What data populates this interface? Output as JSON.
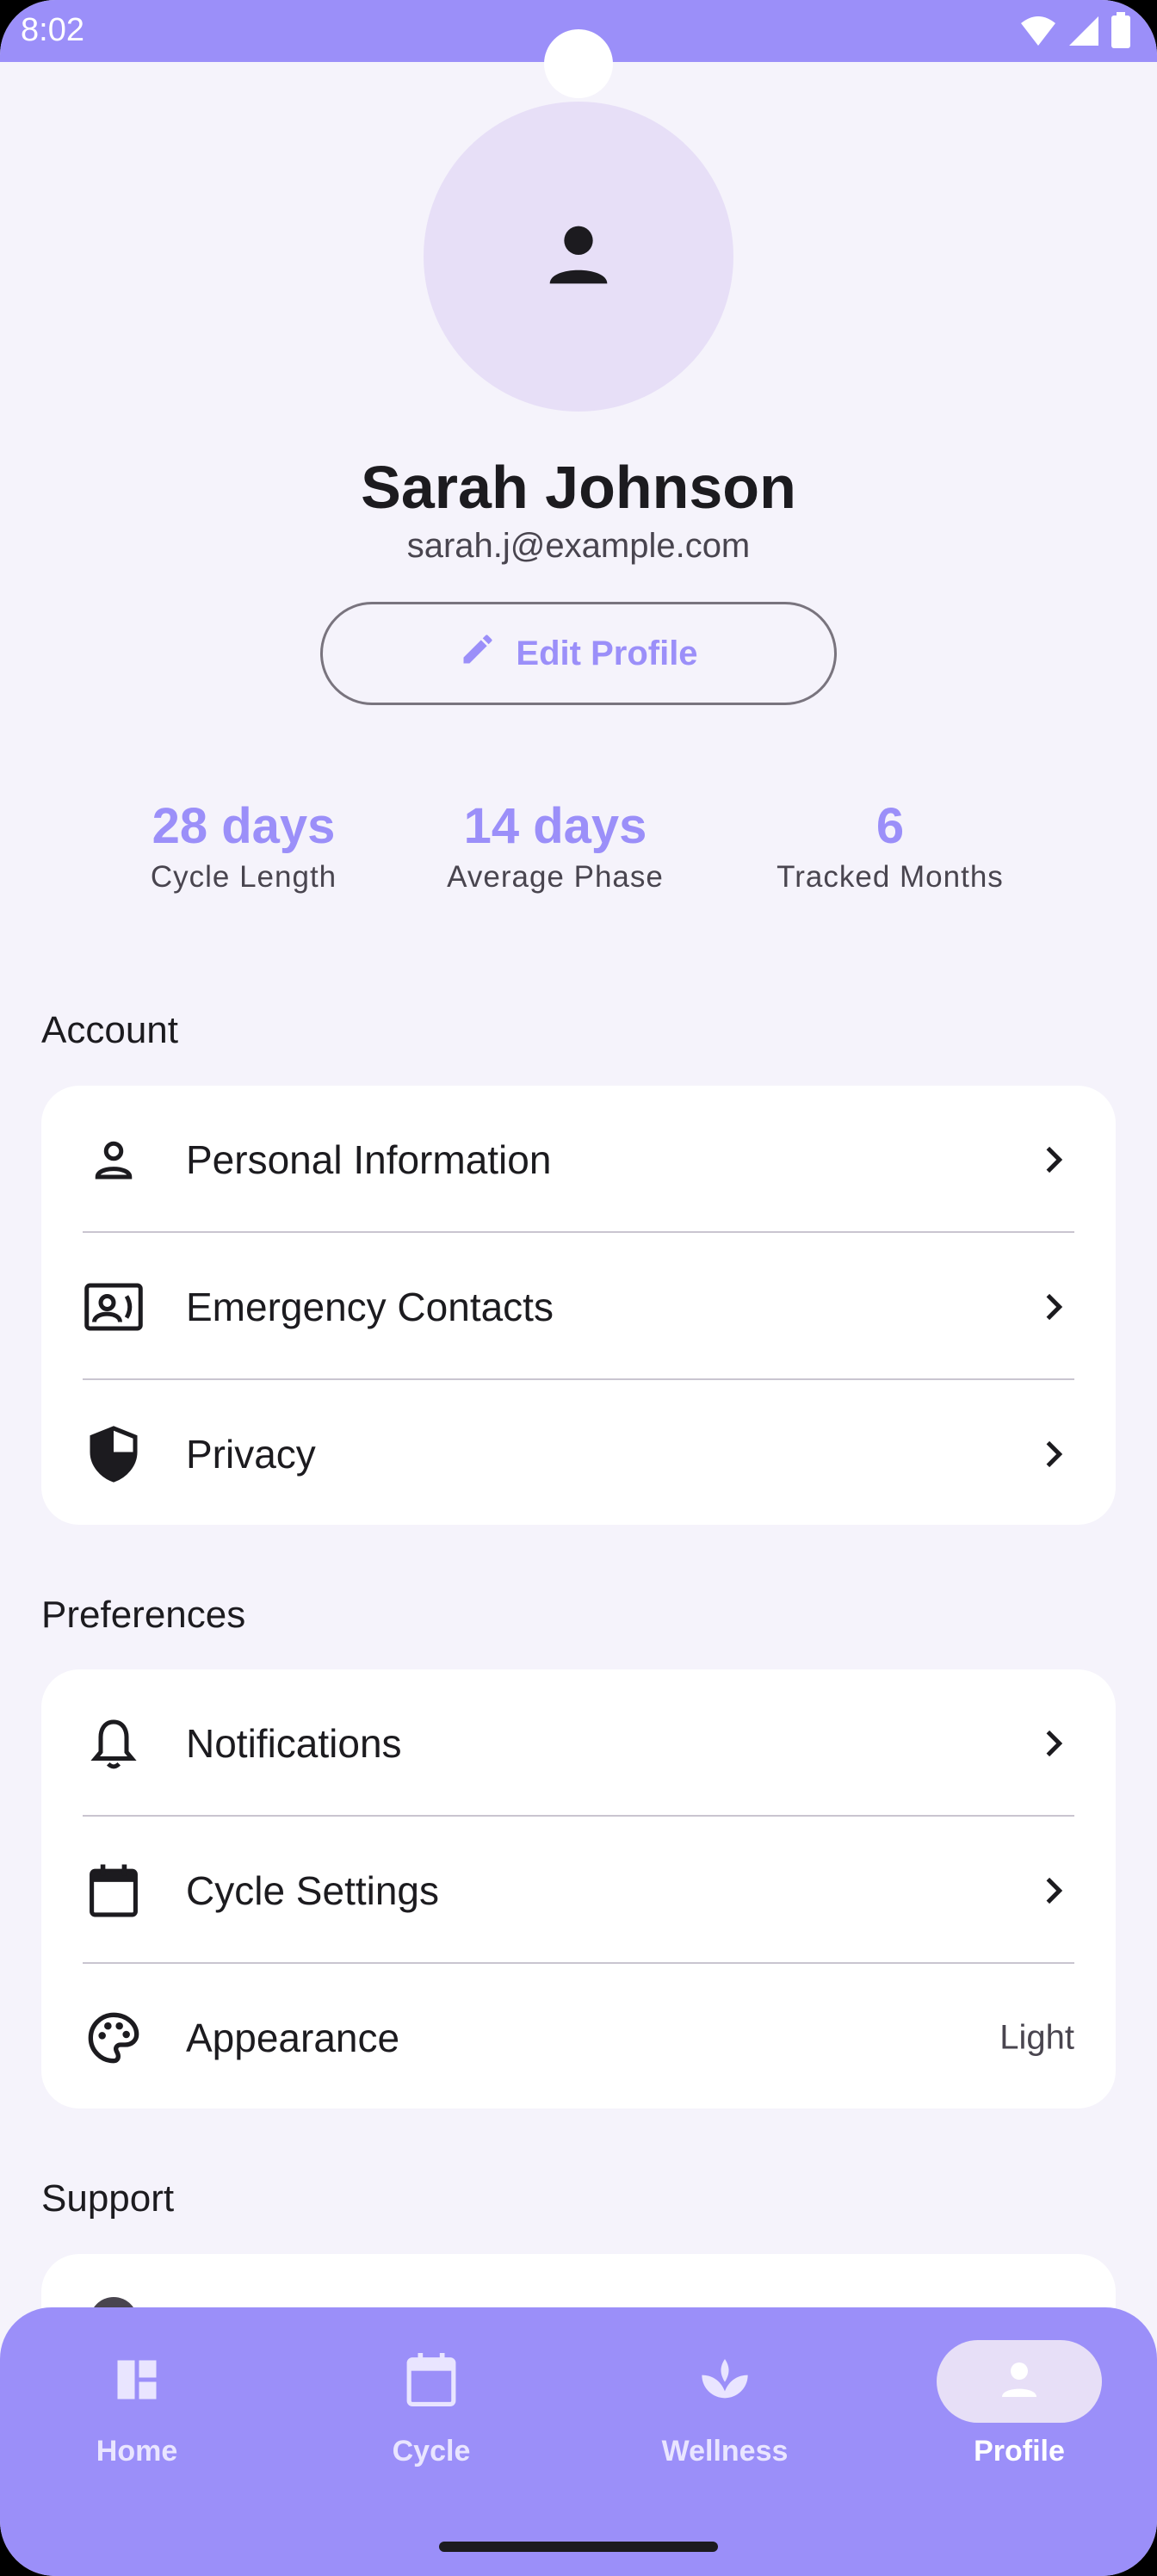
{
  "status_bar": {
    "time": "8:02",
    "icons": [
      "wifi-icon",
      "signal-icon",
      "battery-icon"
    ]
  },
  "profile": {
    "name": "Sarah Johnson",
    "email": "sarah.j@example.com",
    "edit_label": "Edit Profile",
    "avatar_icon": "person-icon"
  },
  "stats": [
    {
      "value": "28 days",
      "label": "Cycle Length"
    },
    {
      "value": "14 days",
      "label": "Average Phase"
    },
    {
      "value": "6",
      "label": "Tracked Months"
    }
  ],
  "sections": {
    "account": {
      "title": "Account",
      "items": [
        {
          "label": "Personal Information",
          "icon": "person-outline-icon"
        },
        {
          "label": "Emergency Contacts",
          "icon": "contact-card-icon"
        },
        {
          "label": "Privacy",
          "icon": "shield-icon"
        }
      ]
    },
    "preferences": {
      "title": "Preferences",
      "items": [
        {
          "label": "Notifications",
          "icon": "bell-icon"
        },
        {
          "label": "Cycle Settings",
          "icon": "calendar-icon"
        },
        {
          "label": "Appearance",
          "icon": "palette-icon",
          "value": "Light"
        }
      ]
    },
    "support": {
      "title": "Support"
    }
  },
  "bottom_nav": {
    "items": [
      {
        "label": "Home",
        "icon": "dashboard-icon",
        "active": false
      },
      {
        "label": "Cycle",
        "icon": "calendar-icon",
        "active": false
      },
      {
        "label": "Wellness",
        "icon": "lotus-icon",
        "active": false
      },
      {
        "label": "Profile",
        "icon": "person-icon",
        "active": true
      }
    ]
  },
  "colors": {
    "accent": "#9B8FF9",
    "background": "#F5F3FB",
    "avatar_bg": "#E7DFF7",
    "text": "#1C1B1F"
  }
}
